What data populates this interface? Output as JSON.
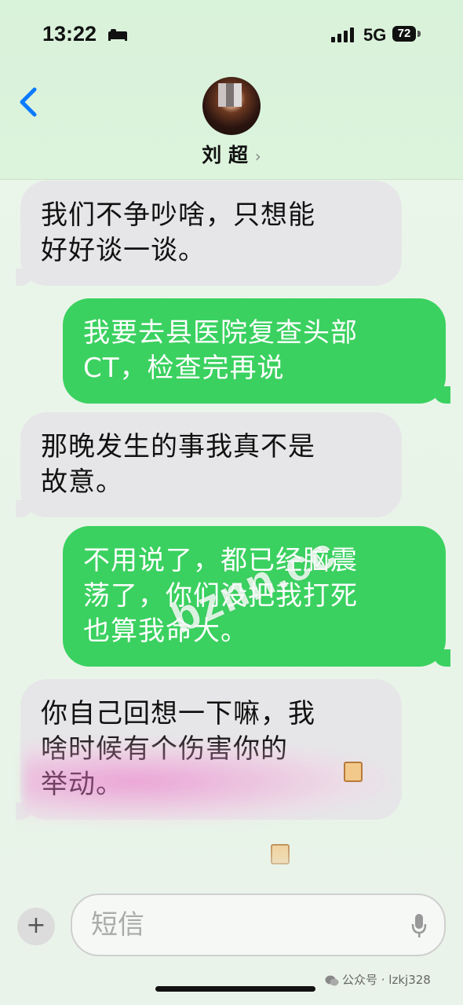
{
  "status_bar": {
    "time": "13:22",
    "network": "5G",
    "battery": "72"
  },
  "contact": {
    "name": "刘  超",
    "chevron": "›"
  },
  "messages": [
    {
      "direction": "incoming",
      "line1": "我们不争吵啥，只想能",
      "line2": "好好谈一谈。"
    },
    {
      "direction": "outgoing",
      "line1": "我要去县医院复查头部",
      "line2": "CT，检查完再说"
    },
    {
      "direction": "incoming",
      "line1": "那晚发生的事我真不是",
      "line2": "故意。"
    },
    {
      "direction": "outgoing",
      "line1": "不用说了，都已经脑震",
      "line2": "荡了，你们没把我打死",
      "line3": "也算我命大。"
    },
    {
      "direction": "incoming",
      "line1": "你自己回想一下嘛，我",
      "line2": "啥时候有个伤害你的",
      "line3": "举动。"
    }
  ],
  "composer": {
    "placeholder": "短信",
    "attach": "+"
  },
  "overlays": {
    "watermark": "bznn.cc",
    "footer": "公众号 · lzkj328"
  },
  "colors": {
    "outgoing_bubble": "#3bd160",
    "incoming_bubble": "#e6e6e8",
    "accent": "#0a7aff"
  },
  "icons": [
    "sleep-icon",
    "signal-icon",
    "battery-icon",
    "back-chevron-icon",
    "avatar",
    "mic-icon",
    "plus-icon",
    "wechat-icon"
  ]
}
